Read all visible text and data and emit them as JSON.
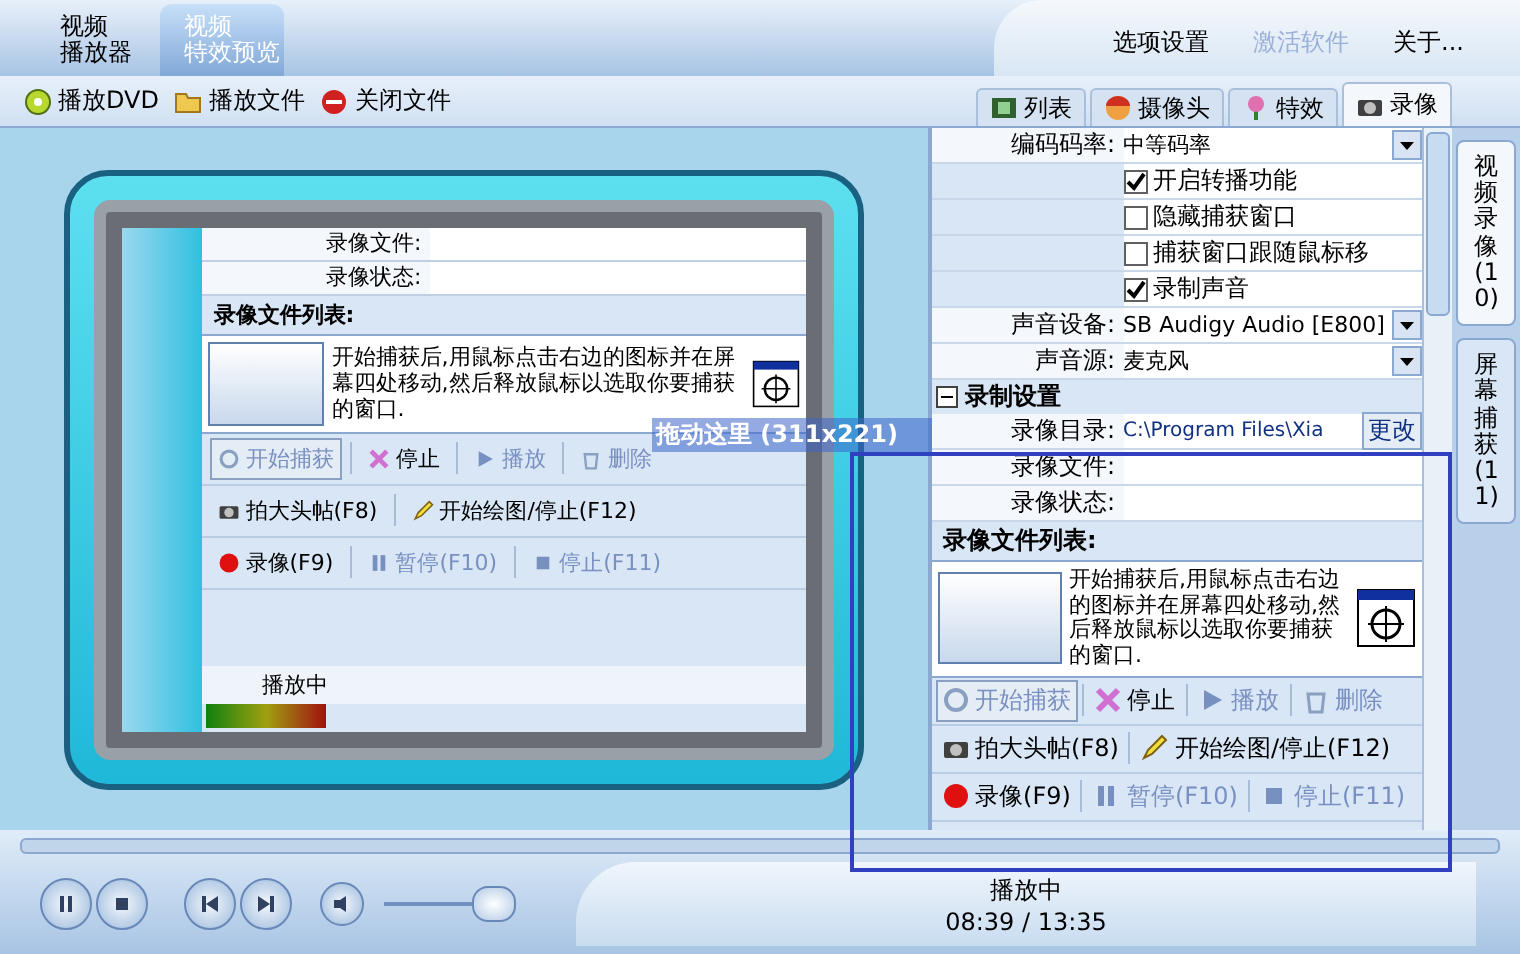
{
  "main_tabs": [
    {
      "lines": [
        "视频",
        "播放器"
      ],
      "selected": false
    },
    {
      "lines": [
        "视频",
        "特效预览"
      ],
      "selected": true
    }
  ],
  "menu": [
    {
      "label": "选项设置",
      "disabled": false
    },
    {
      "label": "激活软件",
      "disabled": true
    },
    {
      "label": "关于...",
      "disabled": false
    }
  ],
  "toolbar": [
    {
      "label": "播放DVD",
      "kind": "disc"
    },
    {
      "label": "播放文件",
      "kind": "folder"
    },
    {
      "label": "关闭文件",
      "kind": "forbid"
    }
  ],
  "panel_tabs": [
    {
      "label": "列表",
      "kind": "list",
      "selected": false
    },
    {
      "label": "摄像头",
      "kind": "face",
      "selected": false
    },
    {
      "label": "特效",
      "kind": "flower",
      "selected": false
    },
    {
      "label": "录像",
      "kind": "camera",
      "selected": true
    }
  ],
  "preview": {
    "fields": [
      {
        "label": "录像文件:"
      },
      {
        "label": "录像状态:"
      }
    ],
    "capture": {
      "list_heading": "录像文件列表:",
      "hint": "开始捕获后,用鼠标点击右边的图标并在屏幕四处移动,然后释放鼠标以选取你要捕获的窗口.",
      "rows": [
        {
          "buttons": [
            {
              "label": "开始捕获",
              "kind": "capture",
              "disabled": true,
              "highlighted": true
            },
            {
              "label": "停止",
              "kind": "cross",
              "disabled": false,
              "highlighted": false
            },
            {
              "label": "播放",
              "kind": "play",
              "disabled": true,
              "highlighted": false
            },
            {
              "label": "删除",
              "kind": "delete",
              "disabled": true,
              "highlighted": false
            }
          ]
        },
        {
          "buttons": [
            {
              "label": "拍大头帖(F8)",
              "kind": "camera",
              "disabled": false,
              "highlighted": false
            },
            {
              "label": "开始绘图/停止(F12)",
              "kind": "pencil",
              "disabled": false,
              "highlighted": false
            }
          ]
        },
        {
          "buttons": [
            {
              "label": "录像(F9)",
              "kind": "record",
              "disabled": false,
              "highlighted": false
            },
            {
              "label": "暂停(F10)",
              "kind": "pause",
              "disabled": true,
              "highlighted": false
            },
            {
              "label": "停止(F11)",
              "kind": "stop",
              "disabled": true,
              "highlighted": false
            }
          ]
        }
      ]
    },
    "status": "播放中"
  },
  "settings": [
    {
      "kind": "dropdown",
      "label": "编码码率:",
      "value": "中等码率"
    },
    {
      "kind": "checkbox",
      "label": "开启转播功能",
      "checked": true
    },
    {
      "kind": "checkbox",
      "label": "隐藏捕获窗口",
      "checked": false
    },
    {
      "kind": "checkbox",
      "label": "捕获窗口跟随鼠标移",
      "checked": false
    },
    {
      "kind": "checkbox",
      "label": "录制声音",
      "checked": true
    },
    {
      "kind": "dropdown",
      "label": "声音设备:",
      "value": "SB Audigy Audio [E800]"
    },
    {
      "kind": "dropdown",
      "label": "声音源:",
      "value": "麦克风"
    },
    {
      "kind": "section",
      "label": "录制设置",
      "expanded": true
    },
    {
      "kind": "path",
      "label": "录像目录:",
      "value": "C:\\Program Files\\Xia",
      "button": "更改"
    },
    {
      "kind": "text",
      "label": "录像文件:"
    },
    {
      "kind": "text",
      "label": "录像状态:"
    }
  ],
  "capture": {
    "list_heading": "录像文件列表:",
    "hint": "开始捕获后,用鼠标点击右边的图标并在屏幕四处移动,然后释放鼠标以选取你要捕获的窗口.",
    "rows": [
      {
        "buttons": [
          {
            "label": "开始捕获",
            "kind": "capture",
            "disabled": true,
            "highlighted": true
          },
          {
            "label": "停止",
            "kind": "cross",
            "disabled": false,
            "highlighted": false
          },
          {
            "label": "播放",
            "kind": "play",
            "disabled": true,
            "highlighted": false
          },
          {
            "label": "删除",
            "kind": "delete",
            "disabled": true,
            "highlighted": false
          }
        ]
      },
      {
        "buttons": [
          {
            "label": "拍大头帖(F8)",
            "kind": "camera",
            "disabled": false,
            "highlighted": false
          },
          {
            "label": "开始绘图/停止(F12)",
            "kind": "pencil",
            "disabled": false,
            "highlighted": false
          }
        ]
      },
      {
        "buttons": [
          {
            "label": "录像(F9)",
            "kind": "record",
            "disabled": false,
            "highlighted": false
          },
          {
            "label": "暂停(F10)",
            "kind": "pause",
            "disabled": true,
            "highlighted": false
          },
          {
            "label": "停止(F11)",
            "kind": "stop",
            "disabled": true,
            "highlighted": false
          }
        ]
      }
    ]
  },
  "side_tabs": [
    {
      "label": "视频录像(10)",
      "selected": true
    },
    {
      "label": "屏幕捕获(11)",
      "selected": false
    }
  ],
  "drag_bar": {
    "label": "拖动这里 (311x221)"
  },
  "player": {
    "status": "播放中",
    "time": "08:39 / 13:35",
    "volume": {
      "level": 0.85
    }
  }
}
